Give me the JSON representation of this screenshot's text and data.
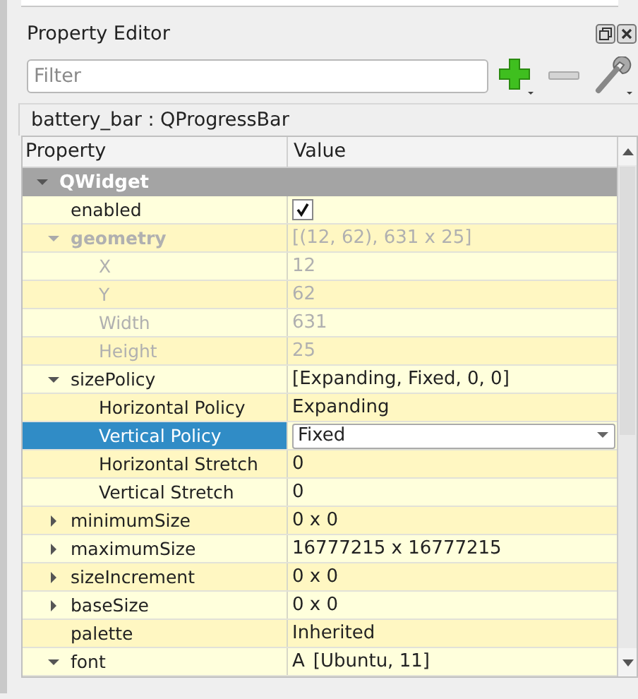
{
  "panel": {
    "title": "Property Editor"
  },
  "filter": {
    "placeholder": "Filter"
  },
  "object_label": "battery_bar : QProgressBar",
  "table": {
    "columns": [
      "Property",
      "Value"
    ],
    "sections": [
      {
        "name": "QWidget",
        "expanded": true,
        "properties": [
          {
            "name": "enabled",
            "kind": "check",
            "checked": true,
            "disabled": false,
            "selected": false
          },
          {
            "name": "geometry",
            "kind": "text",
            "value": "[(12, 62), 631 x 25]",
            "disabled": true,
            "selected": false,
            "expanded": true,
            "children": [
              {
                "name": "X",
                "kind": "text",
                "value": "12",
                "disabled": true,
                "selected": false
              },
              {
                "name": "Y",
                "kind": "text",
                "value": "62",
                "disabled": true,
                "selected": false
              },
              {
                "name": "Width",
                "kind": "text",
                "value": "631",
                "disabled": true,
                "selected": false
              },
              {
                "name": "Height",
                "kind": "text",
                "value": "25",
                "disabled": true,
                "selected": false
              }
            ]
          },
          {
            "name": "sizePolicy",
            "kind": "text",
            "value": "[Expanding, Fixed, 0, 0]",
            "disabled": false,
            "selected": false,
            "expanded": true,
            "children": [
              {
                "name": "Horizontal Policy",
                "kind": "text",
                "value": "Expanding",
                "disabled": false,
                "selected": false
              },
              {
                "name": "Vertical Policy",
                "kind": "combo",
                "value": "Fixed",
                "disabled": false,
                "selected": true
              },
              {
                "name": "Horizontal Stretch",
                "kind": "text",
                "value": "0",
                "disabled": false,
                "selected": false
              },
              {
                "name": "Vertical Stretch",
                "kind": "text",
                "value": "0",
                "disabled": false,
                "selected": false
              }
            ]
          },
          {
            "name": "minimumSize",
            "kind": "text",
            "value": "0 x 0",
            "disabled": false,
            "selected": false,
            "expanded": false
          },
          {
            "name": "maximumSize",
            "kind": "text",
            "value": "16777215 x 16777215",
            "disabled": false,
            "selected": false,
            "expanded": false
          },
          {
            "name": "sizeIncrement",
            "kind": "text",
            "value": "0 x 0",
            "disabled": false,
            "selected": false,
            "expanded": false
          },
          {
            "name": "baseSize",
            "kind": "text",
            "value": "0 x 0",
            "disabled": false,
            "selected": false,
            "expanded": false
          },
          {
            "name": "palette",
            "kind": "text",
            "value": "Inherited",
            "disabled": false,
            "selected": false
          },
          {
            "name": "font",
            "kind": "font",
            "glyph": "A",
            "value": "[Ubuntu, 11]",
            "disabled": false,
            "selected": false,
            "expanded": true
          }
        ]
      }
    ]
  }
}
